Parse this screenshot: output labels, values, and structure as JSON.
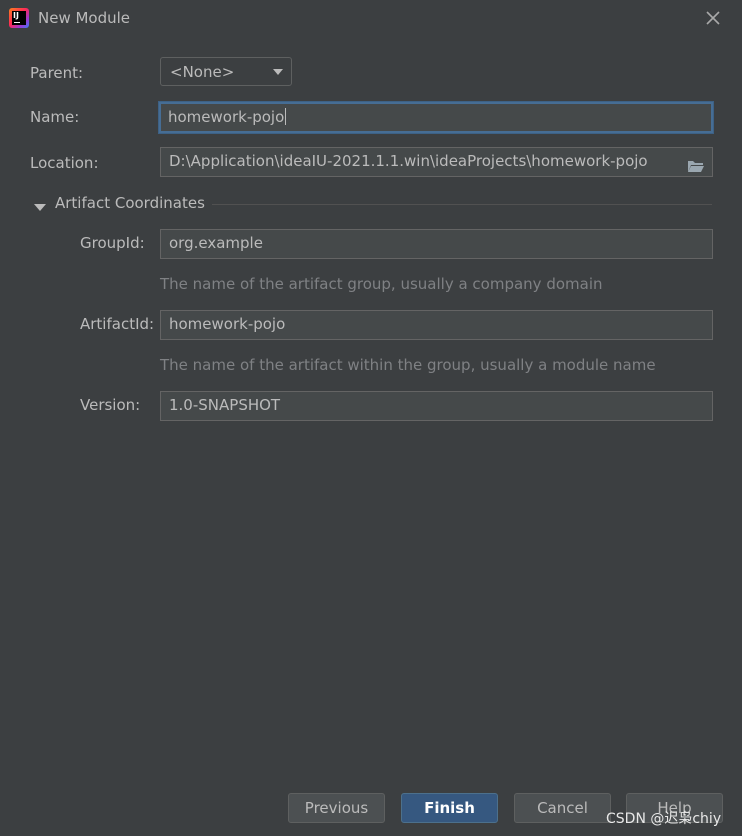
{
  "window": {
    "title": "New Module",
    "icon": "intellij-idea-icon",
    "close_icon": "close-icon"
  },
  "form": {
    "parent_label": "Parent:",
    "parent_value": "<None>",
    "name_label": "Name:",
    "name_value": "homework-pojo",
    "location_label": "Location:",
    "location_value": "D:\\Application\\ideaIU-2021.1.1.win\\ideaProjects\\homework-pojo",
    "location_browse_icon": "folder-icon"
  },
  "artifact": {
    "section_label": "Artifact Coordinates",
    "group_label": "GroupId:",
    "group_value": "org.example",
    "group_hint": "The name of the artifact group, usually a company domain",
    "artifact_label": "ArtifactId:",
    "artifact_value": "homework-pojo",
    "artifact_hint": "The name of the artifact within the group, usually a module name",
    "version_label": "Version:",
    "version_value": "1.0-SNAPSHOT"
  },
  "buttons": {
    "previous": "Previous",
    "finish": "Finish",
    "cancel": "Cancel",
    "help": "Help"
  },
  "watermark": "CSDN @迟枭chiy",
  "colors": {
    "background": "#3c3f41",
    "field_background": "#45494a",
    "focus_border": "#466d94",
    "primary_button": "#365880"
  }
}
